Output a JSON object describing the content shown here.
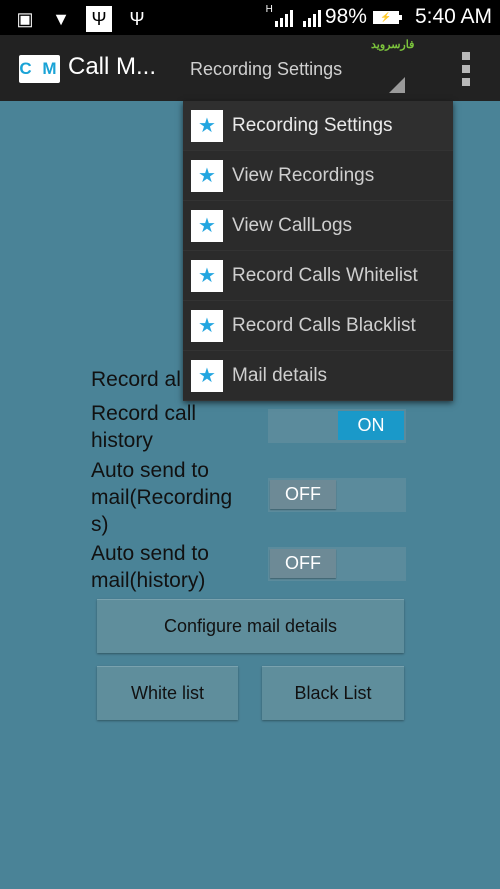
{
  "status_bar": {
    "left_icons": [
      "gallery-icon",
      "shield-icon",
      "usb-debug-icon",
      "usb-icon"
    ],
    "network_type": "H",
    "battery_percent": "98%",
    "time": "5:40 AM"
  },
  "action_bar": {
    "logo_text": "C M",
    "app_title": "Call M...",
    "watermark": "فارسروید",
    "nav_spinner_selected": "Recording Settings",
    "overflow_icon": "overflow-menu-icon"
  },
  "dropdown": {
    "items": [
      {
        "label": "Recording Settings",
        "icon": "star-icon"
      },
      {
        "label": "View Recordings",
        "icon": "star-icon"
      },
      {
        "label": "View CallLogs",
        "icon": "star-icon"
      },
      {
        "label": "Record Calls Whitelist",
        "icon": "star-icon"
      },
      {
        "label": "Record Calls Blacklist",
        "icon": "star-icon"
      },
      {
        "label": "Mail details",
        "icon": "star-icon"
      }
    ]
  },
  "settings": {
    "rows": [
      {
        "label": "Record all",
        "state": "hidden"
      },
      {
        "label": "Record call history",
        "state": "ON"
      },
      {
        "label": "Auto send to mail(Recordings)",
        "state": "OFF"
      },
      {
        "label": "Auto send to mail(history)",
        "state": "OFF"
      }
    ],
    "row0_visible": "Record al",
    "row1_line1": "Record call",
    "row1_line2": "history",
    "row2_line1": "Auto send to",
    "row2_line2": "mail(Recording",
    "row2_line3": "s)",
    "row3_line1": "Auto send to",
    "row3_line2": "mail(history)"
  },
  "buttons": {
    "configure_mail": "Configure mail details",
    "white_list": "White list",
    "black_list": "Black List"
  },
  "colors": {
    "background": "#4a8397",
    "action_bar": "#222222",
    "toggle_on": "#1a99c9",
    "star": "#23a6e0"
  }
}
